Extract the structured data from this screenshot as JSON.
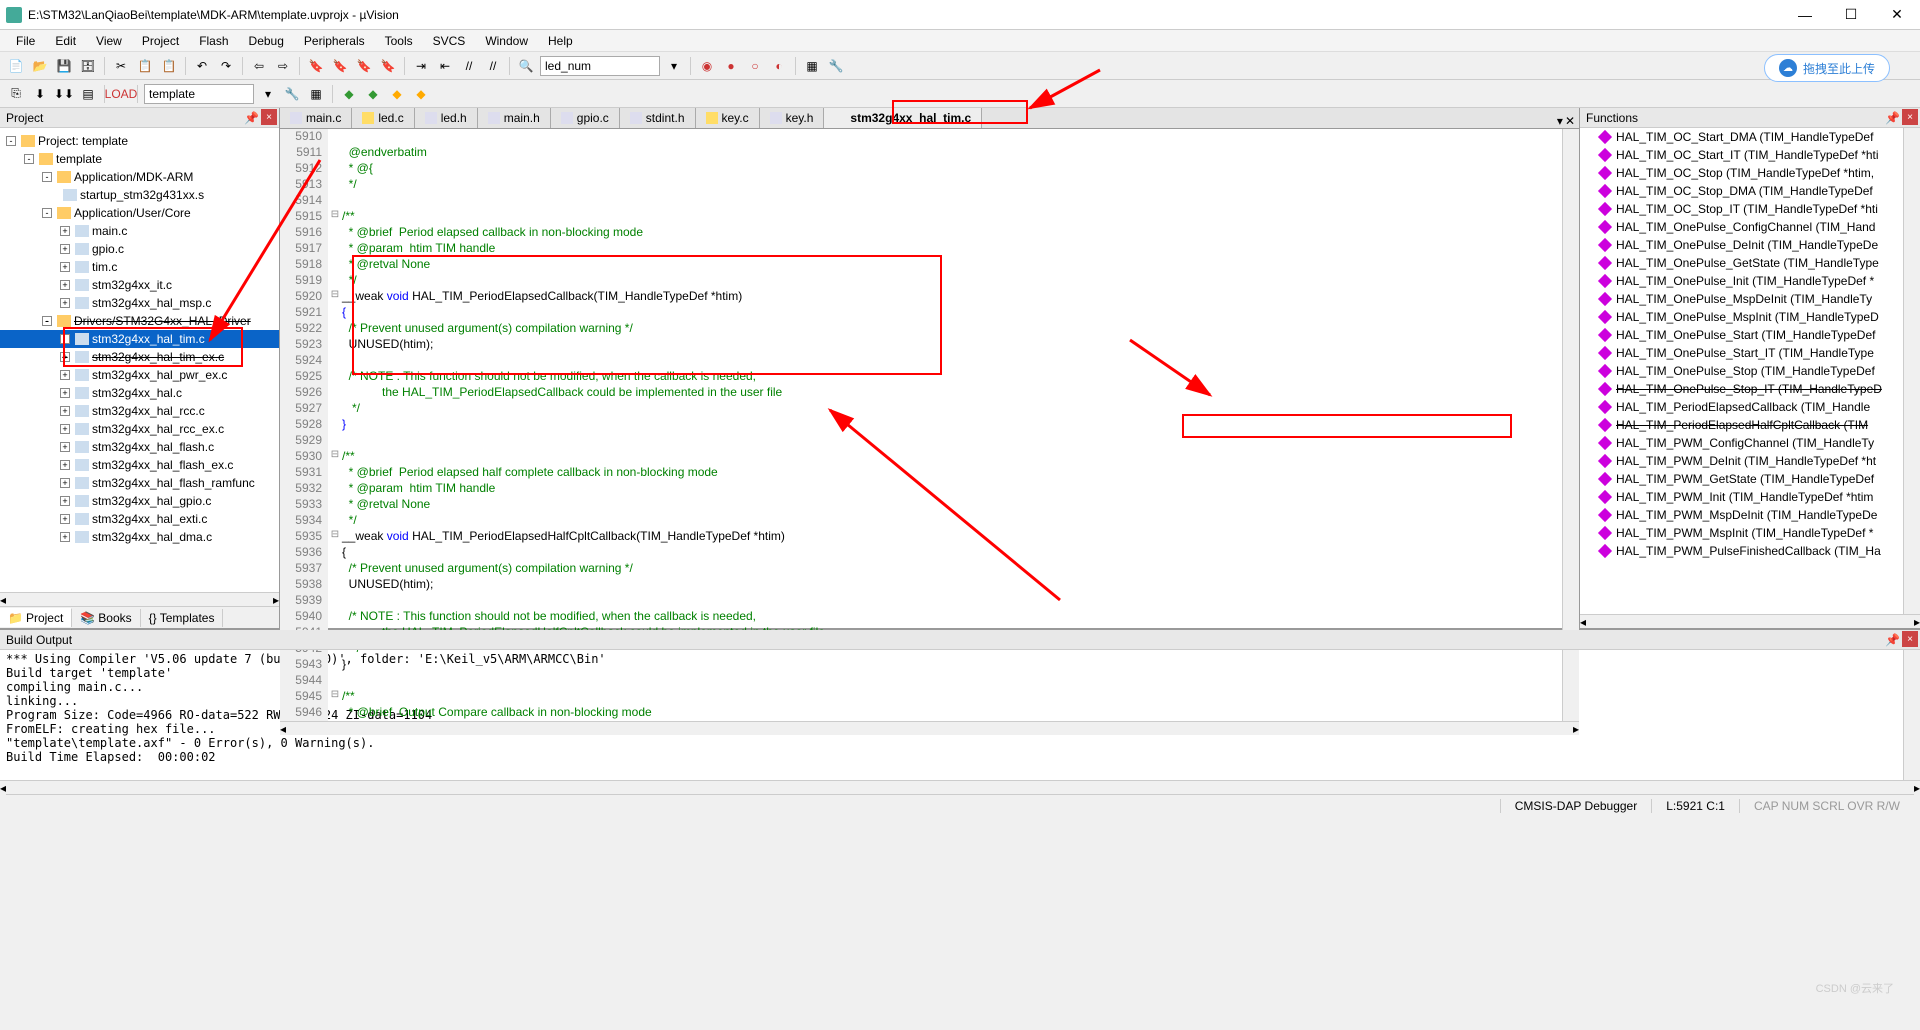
{
  "title": "E:\\STM32\\LanQiaoBei\\template\\MDK-ARM\\template.uvprojx - µVision",
  "menu": [
    "File",
    "Edit",
    "View",
    "Project",
    "Flash",
    "Debug",
    "Peripherals",
    "Tools",
    "SVCS",
    "Window",
    "Help"
  ],
  "combo1": "led_num",
  "combo2": "template",
  "upload": "拖拽至此上传",
  "panels": {
    "project": "Project",
    "functions": "Functions",
    "build": "Build Output"
  },
  "tree": [
    {
      "d": 0,
      "t": "Project: template",
      "k": "folder",
      "exp": "-"
    },
    {
      "d": 1,
      "t": "template",
      "k": "folder",
      "exp": "-"
    },
    {
      "d": 2,
      "t": "Application/MDK-ARM",
      "k": "folder",
      "exp": "-"
    },
    {
      "d": 3,
      "t": "startup_stm32g431xx.s",
      "k": "file"
    },
    {
      "d": 2,
      "t": "Application/User/Core",
      "k": "folder",
      "exp": "-"
    },
    {
      "d": 3,
      "t": "main.c",
      "k": "file",
      "p": "+"
    },
    {
      "d": 3,
      "t": "gpio.c",
      "k": "file",
      "p": "+"
    },
    {
      "d": 3,
      "t": "tim.c",
      "k": "file",
      "p": "+"
    },
    {
      "d": 3,
      "t": "stm32g4xx_it.c",
      "k": "file",
      "p": "+"
    },
    {
      "d": 3,
      "t": "stm32g4xx_hal_msp.c",
      "k": "file",
      "p": "+"
    },
    {
      "d": 2,
      "t": "Drivers/STM32G4xx_HAL_Driver",
      "k": "folder",
      "exp": "-",
      "strike": true
    },
    {
      "d": 3,
      "t": "stm32g4xx_hal_tim.c",
      "k": "file",
      "p": "+",
      "sel": true
    },
    {
      "d": 3,
      "t": "stm32g4xx_hal_tim_ex.c",
      "k": "file",
      "p": "+",
      "strike": true
    },
    {
      "d": 3,
      "t": "stm32g4xx_hal_pwr_ex.c",
      "k": "file",
      "p": "+"
    },
    {
      "d": 3,
      "t": "stm32g4xx_hal.c",
      "k": "file",
      "p": "+"
    },
    {
      "d": 3,
      "t": "stm32g4xx_hal_rcc.c",
      "k": "file",
      "p": "+"
    },
    {
      "d": 3,
      "t": "stm32g4xx_hal_rcc_ex.c",
      "k": "file",
      "p": "+"
    },
    {
      "d": 3,
      "t": "stm32g4xx_hal_flash.c",
      "k": "file",
      "p": "+"
    },
    {
      "d": 3,
      "t": "stm32g4xx_hal_flash_ex.c",
      "k": "file",
      "p": "+"
    },
    {
      "d": 3,
      "t": "stm32g4xx_hal_flash_ramfunc",
      "k": "file",
      "p": "+"
    },
    {
      "d": 3,
      "t": "stm32g4xx_hal_gpio.c",
      "k": "file",
      "p": "+"
    },
    {
      "d": 3,
      "t": "stm32g4xx_hal_exti.c",
      "k": "file",
      "p": "+"
    },
    {
      "d": 3,
      "t": "stm32g4xx_hal_dma.c",
      "k": "file",
      "p": "+"
    }
  ],
  "bottabs": [
    "Project",
    "Books",
    "{} Templates"
  ],
  "etabs": [
    {
      "n": "main.c",
      "c": "#dde"
    },
    {
      "n": "led.c",
      "c": "#fd6"
    },
    {
      "n": "led.h",
      "c": "#dde"
    },
    {
      "n": "main.h",
      "c": "#dde"
    },
    {
      "n": "gpio.c",
      "c": "#dde"
    },
    {
      "n": "stdint.h",
      "c": "#dde"
    },
    {
      "n": "key.c",
      "c": "#fd6"
    },
    {
      "n": "key.h",
      "c": "#dde"
    },
    {
      "n": "stm32g4xx_hal_tim.c",
      "c": "#eee",
      "act": true
    }
  ],
  "code": {
    "first": 5910,
    "lines": [
      {
        "c": "g",
        "t": ""
      },
      {
        "c": "g",
        "t": "  @endverbatim"
      },
      {
        "c": "g",
        "t": "  * @{"
      },
      {
        "c": "g",
        "t": "  */"
      },
      {
        "c": "g",
        "t": ""
      },
      {
        "c": "g",
        "t": "/**"
      },
      {
        "c": "g",
        "t": "  * @brief  Period elapsed callback in non-blocking mode"
      },
      {
        "c": "g",
        "t": "  * @param  htim TIM handle"
      },
      {
        "c": "g",
        "t": "  * @retval None"
      },
      {
        "c": "g",
        "t": "  */"
      },
      {
        "c": "",
        "t": "__weak ",
        "b": "void ",
        "r": "HAL_TIM_PeriodElapsedCallback(TIM_HandleTypeDef *htim)"
      },
      {
        "c": "b",
        "t": "{"
      },
      {
        "c": "g",
        "t": "  /* Prevent unused argument(s) compilation warning */"
      },
      {
        "c": "",
        "t": "  UNUSED(htim);"
      },
      {
        "c": "",
        "t": ""
      },
      {
        "c": "g",
        "t": "  /* NOTE : This function should not be modified, when the callback is needed,"
      },
      {
        "c": "g",
        "t": "            the HAL_TIM_PeriodElapsedCallback could be implemented in the user file"
      },
      {
        "c": "g",
        "t": "   */"
      },
      {
        "c": "b",
        "t": "}"
      },
      {
        "c": "",
        "t": ""
      },
      {
        "c": "g",
        "t": "/**"
      },
      {
        "c": "g",
        "t": "  * @brief  Period elapsed half complete callback in non-blocking mode"
      },
      {
        "c": "g",
        "t": "  * @param  htim TIM handle"
      },
      {
        "c": "g",
        "t": "  * @retval None"
      },
      {
        "c": "g",
        "t": "  */"
      },
      {
        "c": "",
        "t": "__weak ",
        "b": "void ",
        "r": "HAL_TIM_PeriodElapsedHalfCpltCallback(TIM_HandleTypeDef *htim)"
      },
      {
        "c": "",
        "t": "{"
      },
      {
        "c": "g",
        "t": "  /* Prevent unused argument(s) compilation warning */"
      },
      {
        "c": "",
        "t": "  UNUSED(htim);"
      },
      {
        "c": "",
        "t": ""
      },
      {
        "c": "g",
        "t": "  /* NOTE : This function should not be modified, when the callback is needed,"
      },
      {
        "c": "g",
        "t": "            the HAL_TIM_PeriodElapsedHalfCpltCallback could be implemented in the user file"
      },
      {
        "c": "g",
        "t": "   */"
      },
      {
        "c": "",
        "t": "}"
      },
      {
        "c": "",
        "t": ""
      },
      {
        "c": "g",
        "t": "/**"
      },
      {
        "c": "g",
        "t": "  * @brief  Output Compare callback in non-blocking mode"
      }
    ]
  },
  "funcs": [
    "HAL_TIM_OC_Start_DMA (TIM_HandleTypeDef",
    "HAL_TIM_OC_Start_IT (TIM_HandleTypeDef *hti",
    "HAL_TIM_OC_Stop (TIM_HandleTypeDef *htim,",
    "HAL_TIM_OC_Stop_DMA (TIM_HandleTypeDef",
    "HAL_TIM_OC_Stop_IT (TIM_HandleTypeDef *hti",
    "HAL_TIM_OnePulse_ConfigChannel (TIM_Hand",
    "HAL_TIM_OnePulse_DeInit (TIM_HandleTypeDe",
    "HAL_TIM_OnePulse_GetState (TIM_HandleType",
    "HAL_TIM_OnePulse_Init (TIM_HandleTypeDef *",
    "HAL_TIM_OnePulse_MspDeInit (TIM_HandleTy",
    "HAL_TIM_OnePulse_MspInit (TIM_HandleTypeD",
    "HAL_TIM_OnePulse_Start (TIM_HandleTypeDef",
    "HAL_TIM_OnePulse_Start_IT (TIM_HandleType",
    "HAL_TIM_OnePulse_Stop (TIM_HandleTypeDef",
    "HAL_TIM_OnePulse_Stop_IT (TIM_HandleTypeD",
    "HAL_TIM_PeriodElapsedCallback (TIM_Handle",
    "HAL_TIM_PeriodElapsedHalfCpltCallback (TIM",
    "HAL_TIM_PWM_ConfigChannel (TIM_HandleTy",
    "HAL_TIM_PWM_DeInit (TIM_HandleTypeDef *ht",
    "HAL_TIM_PWM_GetState (TIM_HandleTypeDef",
    "HAL_TIM_PWM_Init (TIM_HandleTypeDef *htim",
    "HAL_TIM_PWM_MspDeInit (TIM_HandleTypeDe",
    "HAL_TIM_PWM_MspInit (TIM_HandleTypeDef *",
    "HAL_TIM_PWM_PulseFinishedCallback (TIM_Ha"
  ],
  "func_strikes": [
    14,
    16
  ],
  "build": "*** Using Compiler 'V5.06 update 7 (build 960)', folder: 'E:\\Keil_v5\\ARM\\ARMCC\\Bin'\nBuild target 'template'\ncompiling main.c...\nlinking...\nProgram Size: Code=4966 RO-data=522 RW-data=24 ZI-data=1104\nFromELF: creating hex file...\n\"template\\template.axf\" - 0 Error(s), 0 Warning(s).\nBuild Time Elapsed:  00:00:02",
  "status": {
    "dbg": "CMSIS-DAP Debugger",
    "pos": "L:5921 C:1",
    "caps": "CAP  NUM  SCRL  OVR  R/W"
  }
}
